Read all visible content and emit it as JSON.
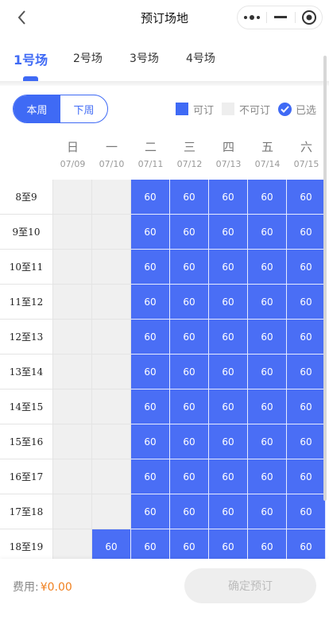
{
  "header": {
    "title": "预订场地"
  },
  "tabs": [
    "1号场",
    "2号场",
    "3号场",
    "4号场"
  ],
  "active_tab": 0,
  "week_toggle": {
    "this_week": "本周",
    "next_week": "下周"
  },
  "legend": {
    "available": "可订",
    "unavailable": "不可订",
    "selected": "已选"
  },
  "days": [
    {
      "weekday": "日",
      "date": "07/09"
    },
    {
      "weekday": "一",
      "date": "07/10"
    },
    {
      "weekday": "二",
      "date": "07/11"
    },
    {
      "weekday": "三",
      "date": "07/12"
    },
    {
      "weekday": "四",
      "date": "07/13"
    },
    {
      "weekday": "五",
      "date": "07/14"
    },
    {
      "weekday": "六",
      "date": "07/15"
    }
  ],
  "slots": [
    {
      "label": "8至9",
      "cells": [
        "",
        "",
        "60",
        "60",
        "60",
        "60",
        "60"
      ]
    },
    {
      "label": "9至10",
      "cells": [
        "",
        "",
        "60",
        "60",
        "60",
        "60",
        "60"
      ]
    },
    {
      "label": "10至11",
      "cells": [
        "",
        "",
        "60",
        "60",
        "60",
        "60",
        "60"
      ]
    },
    {
      "label": "11至12",
      "cells": [
        "",
        "",
        "60",
        "60",
        "60",
        "60",
        "60"
      ]
    },
    {
      "label": "12至13",
      "cells": [
        "",
        "",
        "60",
        "60",
        "60",
        "60",
        "60"
      ]
    },
    {
      "label": "13至14",
      "cells": [
        "",
        "",
        "60",
        "60",
        "60",
        "60",
        "60"
      ]
    },
    {
      "label": "14至15",
      "cells": [
        "",
        "",
        "60",
        "60",
        "60",
        "60",
        "60"
      ]
    },
    {
      "label": "15至16",
      "cells": [
        "",
        "",
        "60",
        "60",
        "60",
        "60",
        "60"
      ]
    },
    {
      "label": "16至17",
      "cells": [
        "",
        "",
        "60",
        "60",
        "60",
        "60",
        "60"
      ]
    },
    {
      "label": "17至18",
      "cells": [
        "",
        "",
        "60",
        "60",
        "60",
        "60",
        "60"
      ]
    },
    {
      "label": "18至19",
      "cells": [
        "",
        "60",
        "60",
        "60",
        "60",
        "60",
        "60"
      ]
    }
  ],
  "footer": {
    "fee_label": "费用:",
    "fee_amount": "¥0.00",
    "confirm_label": "确定预订"
  },
  "colors": {
    "accent": "#3f6af5",
    "unavailable": "#f0f0f0",
    "fee": "#f0801f"
  },
  "icons": [
    "back-chevron-icon",
    "more-dots-icon",
    "minimize-icon",
    "close-target-icon",
    "check-icon"
  ]
}
